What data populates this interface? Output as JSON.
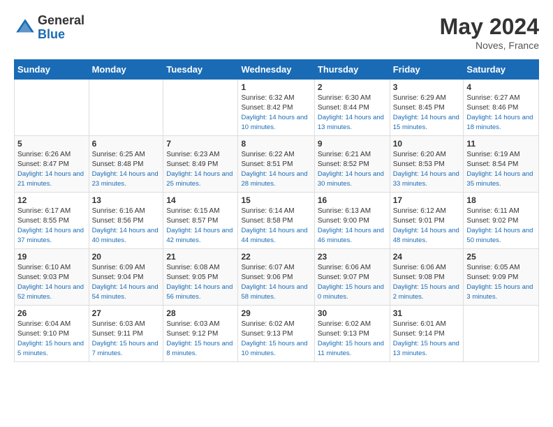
{
  "header": {
    "logo_general": "General",
    "logo_blue": "Blue",
    "month": "May 2024",
    "location": "Noves, France"
  },
  "days_of_week": [
    "Sunday",
    "Monday",
    "Tuesday",
    "Wednesday",
    "Thursday",
    "Friday",
    "Saturday"
  ],
  "weeks": [
    [
      {
        "day": "",
        "info": ""
      },
      {
        "day": "",
        "info": ""
      },
      {
        "day": "",
        "info": ""
      },
      {
        "day": "1",
        "sunrise": "6:32 AM",
        "sunset": "8:42 PM",
        "daylight": "14 hours and 10 minutes."
      },
      {
        "day": "2",
        "sunrise": "6:30 AM",
        "sunset": "8:44 PM",
        "daylight": "14 hours and 13 minutes."
      },
      {
        "day": "3",
        "sunrise": "6:29 AM",
        "sunset": "8:45 PM",
        "daylight": "14 hours and 15 minutes."
      },
      {
        "day": "4",
        "sunrise": "6:27 AM",
        "sunset": "8:46 PM",
        "daylight": "14 hours and 18 minutes."
      }
    ],
    [
      {
        "day": "5",
        "sunrise": "6:26 AM",
        "sunset": "8:47 PM",
        "daylight": "14 hours and 21 minutes."
      },
      {
        "day": "6",
        "sunrise": "6:25 AM",
        "sunset": "8:48 PM",
        "daylight": "14 hours and 23 minutes."
      },
      {
        "day": "7",
        "sunrise": "6:23 AM",
        "sunset": "8:49 PM",
        "daylight": "14 hours and 25 minutes."
      },
      {
        "day": "8",
        "sunrise": "6:22 AM",
        "sunset": "8:51 PM",
        "daylight": "14 hours and 28 minutes."
      },
      {
        "day": "9",
        "sunrise": "6:21 AM",
        "sunset": "8:52 PM",
        "daylight": "14 hours and 30 minutes."
      },
      {
        "day": "10",
        "sunrise": "6:20 AM",
        "sunset": "8:53 PM",
        "daylight": "14 hours and 33 minutes."
      },
      {
        "day": "11",
        "sunrise": "6:19 AM",
        "sunset": "8:54 PM",
        "daylight": "14 hours and 35 minutes."
      }
    ],
    [
      {
        "day": "12",
        "sunrise": "6:17 AM",
        "sunset": "8:55 PM",
        "daylight": "14 hours and 37 minutes."
      },
      {
        "day": "13",
        "sunrise": "6:16 AM",
        "sunset": "8:56 PM",
        "daylight": "14 hours and 40 minutes."
      },
      {
        "day": "14",
        "sunrise": "6:15 AM",
        "sunset": "8:57 PM",
        "daylight": "14 hours and 42 minutes."
      },
      {
        "day": "15",
        "sunrise": "6:14 AM",
        "sunset": "8:58 PM",
        "daylight": "14 hours and 44 minutes."
      },
      {
        "day": "16",
        "sunrise": "6:13 AM",
        "sunset": "9:00 PM",
        "daylight": "14 hours and 46 minutes."
      },
      {
        "day": "17",
        "sunrise": "6:12 AM",
        "sunset": "9:01 PM",
        "daylight": "14 hours and 48 minutes."
      },
      {
        "day": "18",
        "sunrise": "6:11 AM",
        "sunset": "9:02 PM",
        "daylight": "14 hours and 50 minutes."
      }
    ],
    [
      {
        "day": "19",
        "sunrise": "6:10 AM",
        "sunset": "9:03 PM",
        "daylight": "14 hours and 52 minutes."
      },
      {
        "day": "20",
        "sunrise": "6:09 AM",
        "sunset": "9:04 PM",
        "daylight": "14 hours and 54 minutes."
      },
      {
        "day": "21",
        "sunrise": "6:08 AM",
        "sunset": "9:05 PM",
        "daylight": "14 hours and 56 minutes."
      },
      {
        "day": "22",
        "sunrise": "6:07 AM",
        "sunset": "9:06 PM",
        "daylight": "14 hours and 58 minutes."
      },
      {
        "day": "23",
        "sunrise": "6:06 AM",
        "sunset": "9:07 PM",
        "daylight": "15 hours and 0 minutes."
      },
      {
        "day": "24",
        "sunrise": "6:06 AM",
        "sunset": "9:08 PM",
        "daylight": "15 hours and 2 minutes."
      },
      {
        "day": "25",
        "sunrise": "6:05 AM",
        "sunset": "9:09 PM",
        "daylight": "15 hours and 3 minutes."
      }
    ],
    [
      {
        "day": "26",
        "sunrise": "6:04 AM",
        "sunset": "9:10 PM",
        "daylight": "15 hours and 5 minutes."
      },
      {
        "day": "27",
        "sunrise": "6:03 AM",
        "sunset": "9:11 PM",
        "daylight": "15 hours and 7 minutes."
      },
      {
        "day": "28",
        "sunrise": "6:03 AM",
        "sunset": "9:12 PM",
        "daylight": "15 hours and 8 minutes."
      },
      {
        "day": "29",
        "sunrise": "6:02 AM",
        "sunset": "9:13 PM",
        "daylight": "15 hours and 10 minutes."
      },
      {
        "day": "30",
        "sunrise": "6:02 AM",
        "sunset": "9:13 PM",
        "daylight": "15 hours and 11 minutes."
      },
      {
        "day": "31",
        "sunrise": "6:01 AM",
        "sunset": "9:14 PM",
        "daylight": "15 hours and 13 minutes."
      },
      {
        "day": "",
        "info": ""
      }
    ]
  ],
  "labels": {
    "sunrise_prefix": "Sunrise: ",
    "sunset_prefix": "Sunset: ",
    "daylight_label": "Daylight: "
  }
}
